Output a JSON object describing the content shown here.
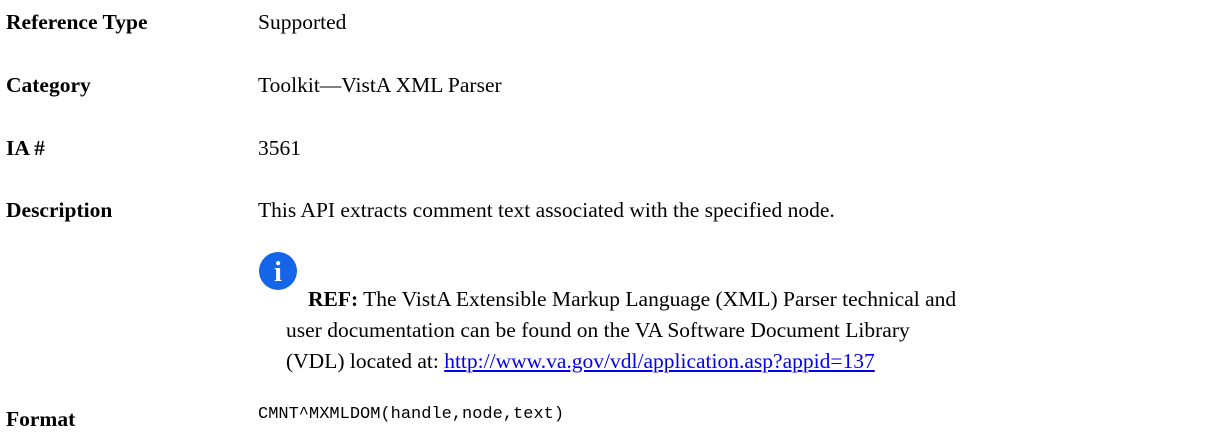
{
  "entries": [
    {
      "term": "Reference Type",
      "value": "Supported"
    },
    {
      "term": "Category",
      "value": "Toolkit—VistA XML Parser"
    },
    {
      "term": "IA #",
      "value": "3561"
    },
    {
      "term": "Description",
      "value": "This API extracts comment text associated with the specified node."
    }
  ],
  "note": {
    "icon": "info-icon",
    "label": "REF:",
    "line1": "The VistA Extensible Markup Language (XML) Parser technical and",
    "line2": "user documentation can be found on the VA Software Document Library",
    "line3_prefix": "(VDL) located at: ",
    "link": "http://www.va.gov/vdl/application.asp?appid=137"
  },
  "format": {
    "term": "Format",
    "value": "CMNT^MXMLDOM(handle,node,text)"
  },
  "colors": {
    "link": "#0000ee",
    "icon": "#1565e8"
  }
}
